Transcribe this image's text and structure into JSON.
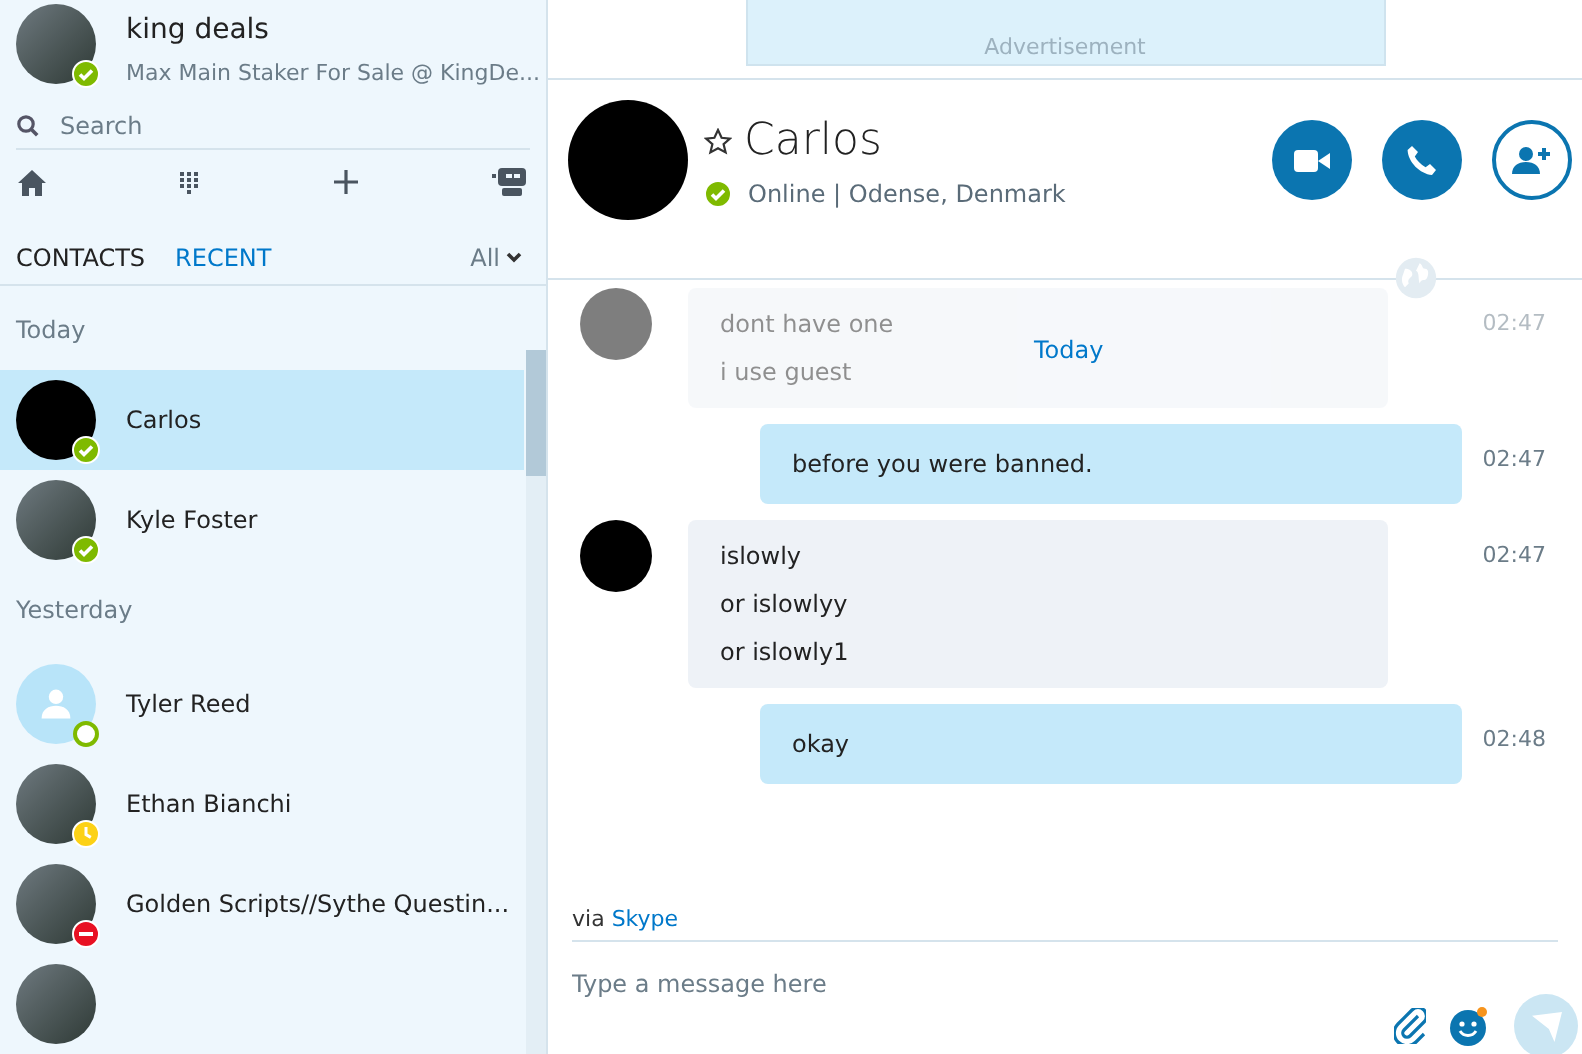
{
  "profile": {
    "name": "king deals",
    "mood": "Max Main Staker For Sale @ KingDe...",
    "badge": {
      "kind": "check",
      "color": "#7fba00"
    }
  },
  "search": {
    "placeholder": "Search"
  },
  "list_tabs": [
    {
      "label": "CONTACTS",
      "selected": false
    },
    {
      "label": "RECENT",
      "selected": true
    }
  ],
  "filter": {
    "label": "All"
  },
  "groups": [
    {
      "label": "Today",
      "contacts": [
        {
          "name": "Carlos",
          "kind": "dark",
          "badge": {
            "kind": "check",
            "color": "#7fba00"
          },
          "selected": true
        },
        {
          "name": "Kyle Foster",
          "kind": "photo",
          "badge": {
            "kind": "check",
            "color": "#7fba00"
          },
          "selected": false
        }
      ]
    },
    {
      "label": "Yesterday",
      "contacts": [
        {
          "name": "Tyler Reed",
          "kind": "default",
          "badge": {
            "kind": "ring",
            "color": "#7fba00"
          },
          "selected": false
        },
        {
          "name": "Ethan Bianchi",
          "kind": "photo",
          "badge": {
            "kind": "clock",
            "color": "#fcd116"
          },
          "selected": false
        },
        {
          "name": "Golden Scripts//Sythe Questin...",
          "kind": "photo",
          "badge": {
            "kind": "minus",
            "color": "#e81123"
          },
          "selected": false
        },
        {
          "kind": "photo",
          "selected": false
        }
      ]
    }
  ],
  "advertisement": {
    "label": "Advertisement"
  },
  "conversation": {
    "name": "Carlos",
    "badge": {
      "kind": "check",
      "color": "#7fba00"
    },
    "presence": "Online | Odense, Denmark",
    "favorite": false
  },
  "date_separator": "Today",
  "messages": [
    {
      "kind": "incoming",
      "faded": true,
      "lines": [
        "dont have one",
        "i use guest"
      ],
      "time": "02:47"
    },
    {
      "kind": "outgoing",
      "faded": false,
      "lines": [
        "before you were banned."
      ],
      "time": "02:47"
    },
    {
      "kind": "incoming",
      "faded": false,
      "lines": [
        "islowly",
        "or islowlyy",
        "or islowly1"
      ],
      "time": "02:47"
    },
    {
      "kind": "outgoing",
      "faded": false,
      "lines": [
        "okay"
      ],
      "time": "02:48"
    }
  ],
  "via": {
    "prefix": "via",
    "service": "Skype"
  },
  "composer": {
    "placeholder": "Type a message here"
  }
}
